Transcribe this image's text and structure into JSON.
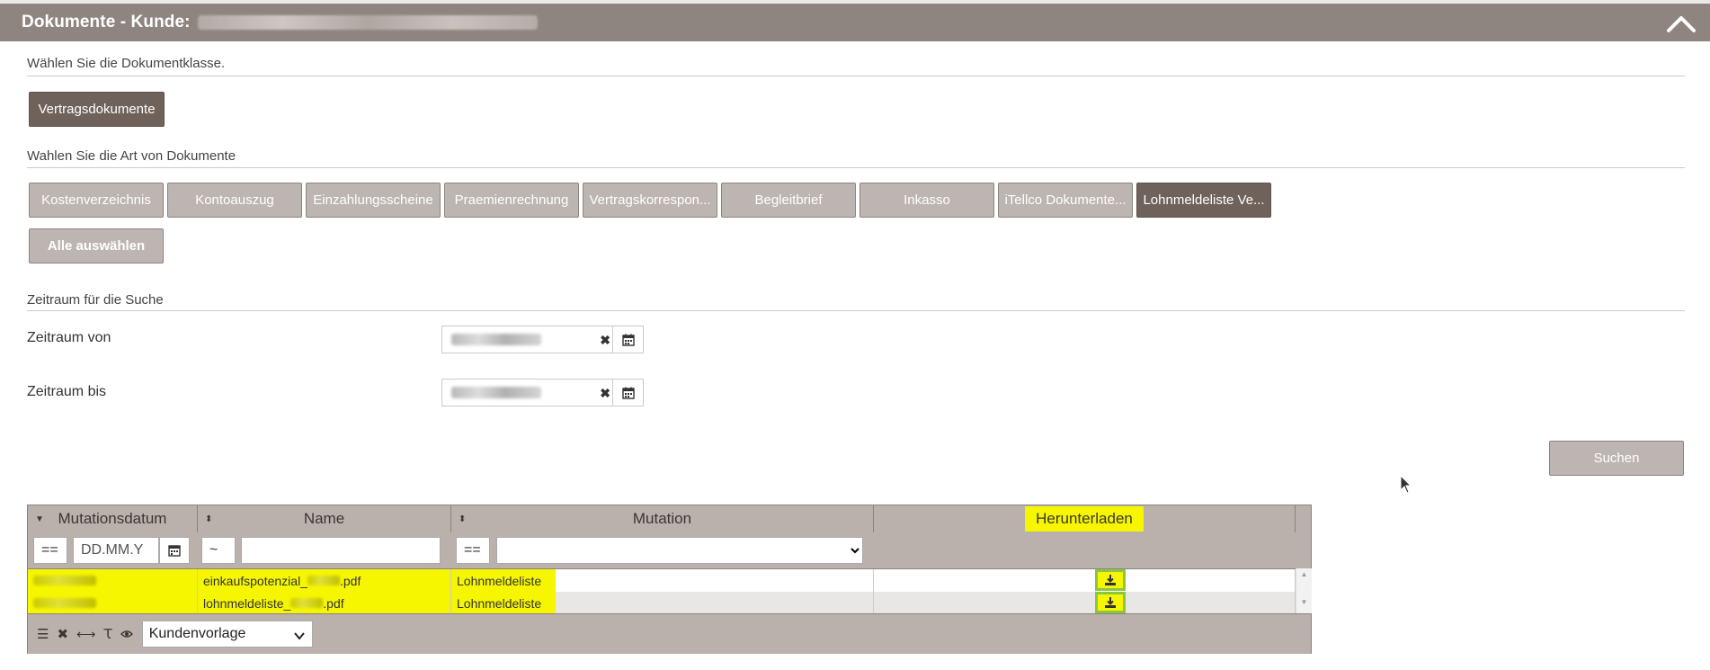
{
  "header": {
    "title": "Dokumente - Kunde:",
    "collapse_icon": "chevron-up-icon"
  },
  "document_class": {
    "label": "Wählen Sie die Dokumentklasse.",
    "selected": "Vertragsdokumente"
  },
  "document_types": {
    "label": "Wahlen Sie die Art von Dokumente",
    "items": [
      "Kostenverzeichnis",
      "Kontoauszug",
      "Einzahlungsscheine",
      "Praemienrechnung",
      "Vertragskorrespon...",
      "Begleitbrief",
      "Inkasso",
      "iTellco Dokumente...",
      "Lohnmeldeliste Ve..."
    ],
    "selected": "Lohnmeldeliste Ve...",
    "select_all": "Alle auswählen"
  },
  "period": {
    "label": "Zeitraum für die Suche",
    "from_label": "Zeitraum von",
    "to_label": "Zeitraum bis"
  },
  "search_button": "Suchen",
  "grid": {
    "columns": [
      "Mutationsdatum",
      "Name",
      "Mutation",
      "Herunterladen"
    ],
    "filters": {
      "date_operator": "==",
      "date_placeholder": "DD.MM.Y",
      "name_operator": "~",
      "mutation_operator": "=="
    },
    "rows": [
      {
        "name_prefix": "einkaufspotenzial_",
        "name_suffix": ".pdf",
        "mutation": "Lohnmeldeliste"
      },
      {
        "name_prefix": "lohnmeldeliste_",
        "name_suffix": ".pdf",
        "mutation": "Lohnmeldeliste"
      }
    ],
    "footer": {
      "layout_select": "Kundenvorlage",
      "icons": [
        "list-icon",
        "clear-icon",
        "resize-columns-icon",
        "text-format-icon",
        "eye-icon"
      ]
    }
  },
  "colors": {
    "header_bg": "#8f8580",
    "button_light": "#bdb5b1",
    "button_dark": "#6f625b",
    "highlight": "#f6f600",
    "download_border": "#8cc63f"
  }
}
